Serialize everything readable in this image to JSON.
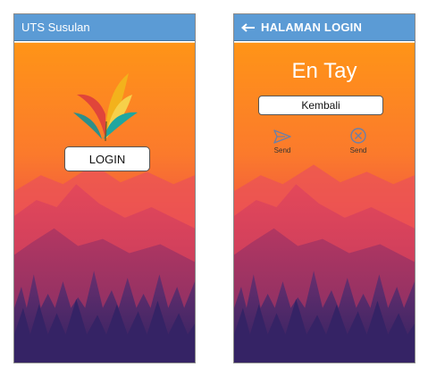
{
  "screens": [
    {
      "appbar_title": "UTS Susulan",
      "login_button": "LOGIN"
    },
    {
      "appbar_title": "HALAMAN LOGIN",
      "name": "En Tay",
      "back_button": "Kembali",
      "actions": [
        {
          "label": "Send",
          "icon": "send-icon"
        },
        {
          "label": "Send",
          "icon": "close-circle-icon"
        }
      ]
    }
  ],
  "colors": {
    "appbar": "#5b9bd5",
    "sky_top": "#ff8f1f",
    "sky_bottom": "#e8464d",
    "mountains": "#a43a5e",
    "forest": "#3f2666"
  }
}
